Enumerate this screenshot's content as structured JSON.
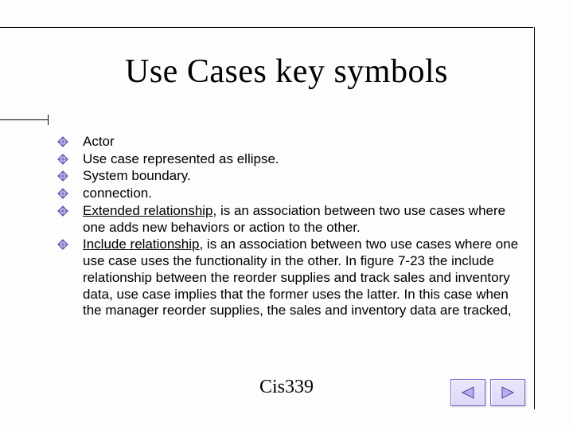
{
  "title": "Use Cases key symbols",
  "bullets": [
    {
      "text": "Actor"
    },
    {
      "text": "Use case represented as ellipse."
    },
    {
      "text": "System boundary."
    },
    {
      "text": " connection."
    },
    {
      "lead": "Extended relationship",
      "rest": ", is an association between two use cases where one adds new behaviors or action to the other."
    },
    {
      "lead": "Include relationship",
      "rest": ", is an association between two use cases where one use case uses the functionality in the other. In figure 7-23 the include relationship between the reorder supplies and track sales and inventory data, use case implies that the former uses the latter. In this case when the manager reorder supplies, the sales and inventory data are tracked,"
    }
  ],
  "footer": "Cis339",
  "nav": {
    "prev": "previous",
    "next": "next"
  }
}
